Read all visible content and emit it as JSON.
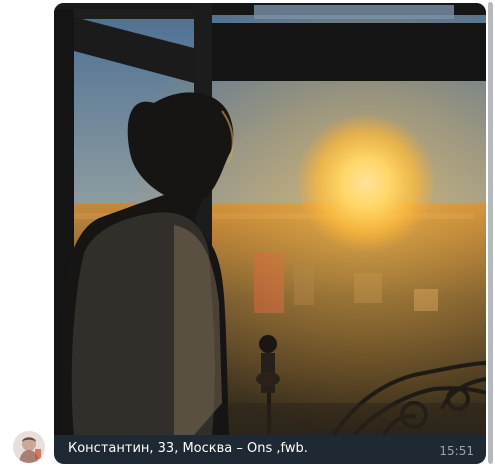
{
  "message": {
    "caption": "Константин, 33, Москва – Ons ,fwb.",
    "time": "15:51",
    "photo_description": "sunset-window-photo"
  },
  "colors": {
    "caption_bg": "#1f2933",
    "caption_text": "#ffffff",
    "time_text": "#9aa3ab",
    "scrollbar": "#b5b9bd"
  },
  "icons": {
    "avatar": "user-avatar-icon"
  }
}
